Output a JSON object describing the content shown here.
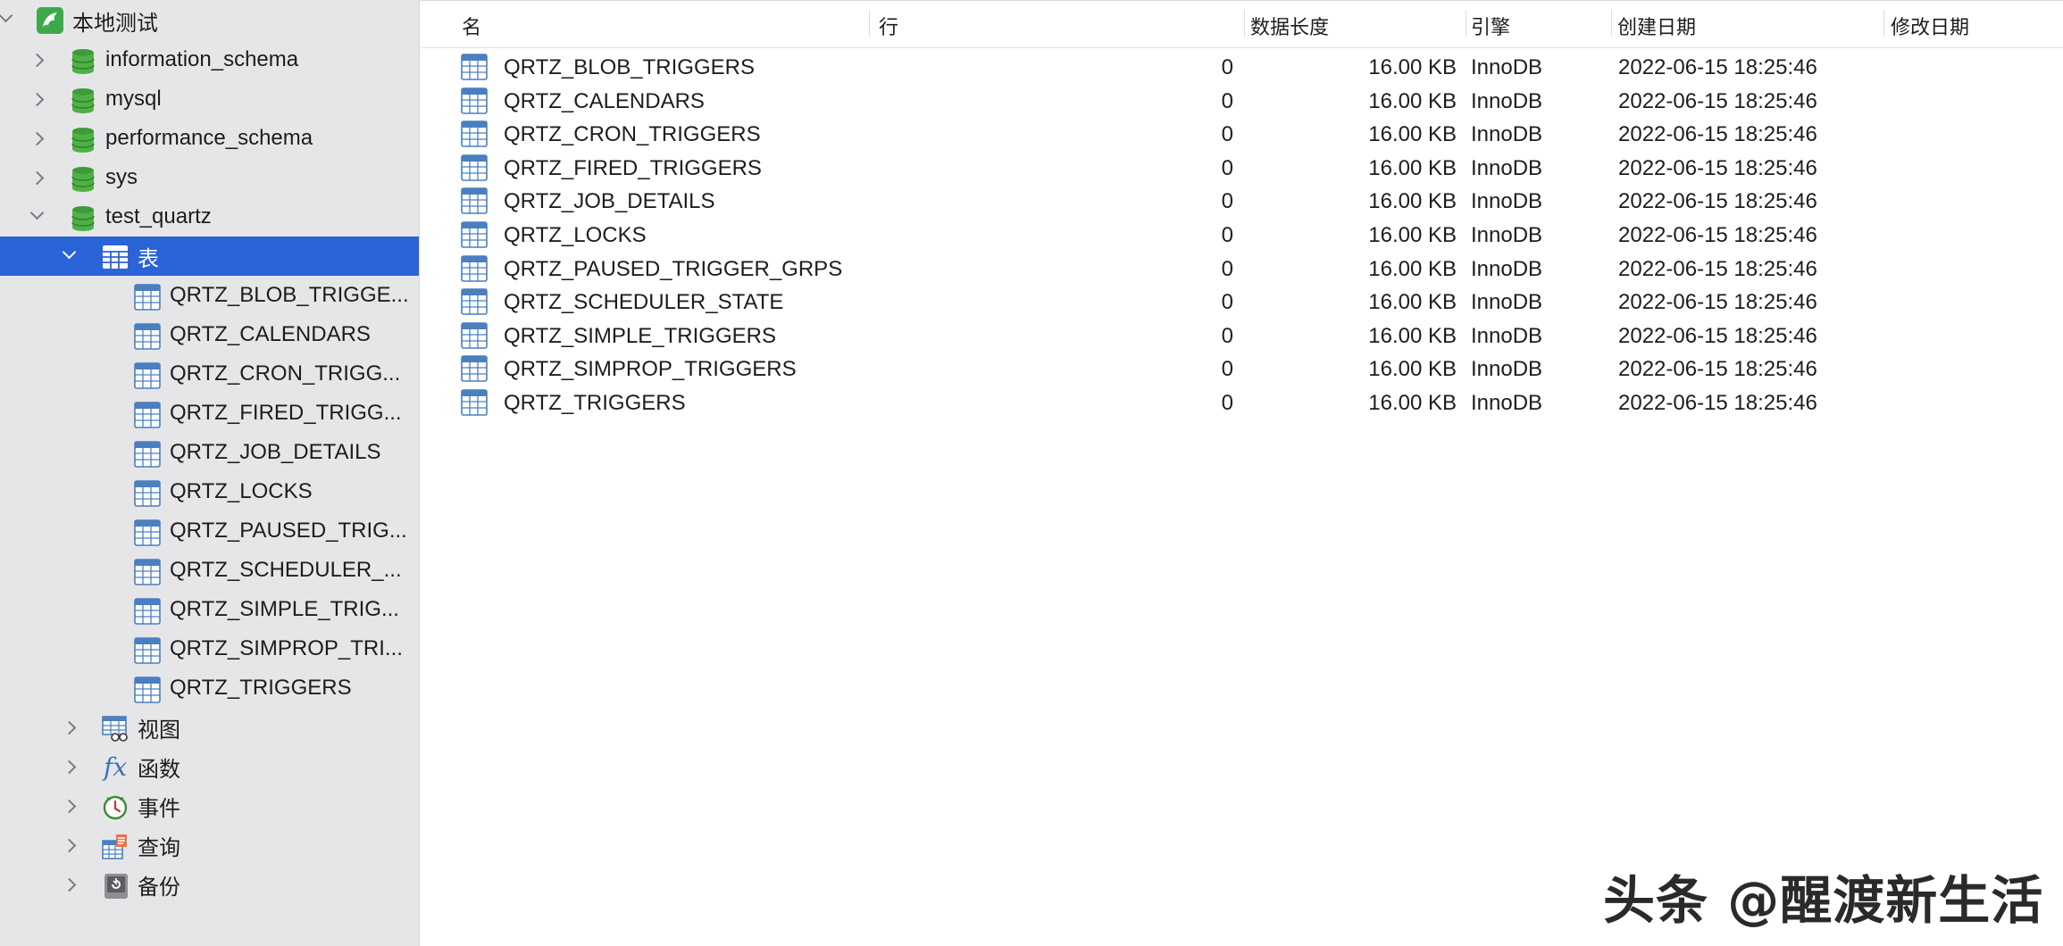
{
  "sidebar": {
    "connection": {
      "label": "本地测试",
      "icon": "dolphin-connection-icon"
    },
    "databases": [
      {
        "label": "information_schema",
        "icon": "database-icon"
      },
      {
        "label": "mysql",
        "icon": "database-icon"
      },
      {
        "label": "performance_schema",
        "icon": "database-icon"
      },
      {
        "label": "sys",
        "icon": "database-icon"
      },
      {
        "label": "test_quartz",
        "icon": "database-icon",
        "expanded": true
      }
    ],
    "tables_group": {
      "label": "表",
      "selected": true
    },
    "tables": [
      "QRTZ_BLOB_TRIGGE...",
      "QRTZ_CALENDARS",
      "QRTZ_CRON_TRIGG...",
      "QRTZ_FIRED_TRIGG...",
      "QRTZ_JOB_DETAILS",
      "QRTZ_LOCKS",
      "QRTZ_PAUSED_TRIG...",
      "QRTZ_SCHEDULER_...",
      "QRTZ_SIMPLE_TRIG...",
      "QRTZ_SIMPROP_TRI...",
      "QRTZ_TRIGGERS"
    ],
    "other_groups": [
      {
        "label": "视图",
        "icon": "view-icon"
      },
      {
        "label": "函数",
        "icon": "function-icon"
      },
      {
        "label": "事件",
        "icon": "event-clock-icon"
      },
      {
        "label": "查询",
        "icon": "query-icon"
      },
      {
        "label": "备份",
        "icon": "backup-icon"
      }
    ]
  },
  "table_view": {
    "columns": {
      "name": "名",
      "rows": "行",
      "data_length": "数据长度",
      "engine": "引擎",
      "created": "创建日期",
      "modified": "修改日期"
    },
    "rows": [
      {
        "name": "QRTZ_BLOB_TRIGGERS",
        "rows": "0",
        "data_length": "16.00 KB",
        "engine": "InnoDB",
        "created": "2022-06-15 18:25:46",
        "modified": ""
      },
      {
        "name": "QRTZ_CALENDARS",
        "rows": "0",
        "data_length": "16.00 KB",
        "engine": "InnoDB",
        "created": "2022-06-15 18:25:46",
        "modified": ""
      },
      {
        "name": "QRTZ_CRON_TRIGGERS",
        "rows": "0",
        "data_length": "16.00 KB",
        "engine": "InnoDB",
        "created": "2022-06-15 18:25:46",
        "modified": ""
      },
      {
        "name": "QRTZ_FIRED_TRIGGERS",
        "rows": "0",
        "data_length": "16.00 KB",
        "engine": "InnoDB",
        "created": "2022-06-15 18:25:46",
        "modified": ""
      },
      {
        "name": "QRTZ_JOB_DETAILS",
        "rows": "0",
        "data_length": "16.00 KB",
        "engine": "InnoDB",
        "created": "2022-06-15 18:25:46",
        "modified": ""
      },
      {
        "name": "QRTZ_LOCKS",
        "rows": "0",
        "data_length": "16.00 KB",
        "engine": "InnoDB",
        "created": "2022-06-15 18:25:46",
        "modified": ""
      },
      {
        "name": "QRTZ_PAUSED_TRIGGER_GRPS",
        "rows": "0",
        "data_length": "16.00 KB",
        "engine": "InnoDB",
        "created": "2022-06-15 18:25:46",
        "modified": ""
      },
      {
        "name": "QRTZ_SCHEDULER_STATE",
        "rows": "0",
        "data_length": "16.00 KB",
        "engine": "InnoDB",
        "created": "2022-06-15 18:25:46",
        "modified": ""
      },
      {
        "name": "QRTZ_SIMPLE_TRIGGERS",
        "rows": "0",
        "data_length": "16.00 KB",
        "engine": "InnoDB",
        "created": "2022-06-15 18:25:46",
        "modified": ""
      },
      {
        "name": "QRTZ_SIMPROP_TRIGGERS",
        "rows": "0",
        "data_length": "16.00 KB",
        "engine": "InnoDB",
        "created": "2022-06-15 18:25:46",
        "modified": ""
      },
      {
        "name": "QRTZ_TRIGGERS",
        "rows": "0",
        "data_length": "16.00 KB",
        "engine": "InnoDB",
        "created": "2022-06-15 18:25:46",
        "modified": ""
      }
    ]
  },
  "watermark": "头条 @醒渡新生活",
  "colors": {
    "sidebar_bg": "#e6e6e8",
    "selection": "#2b63d9",
    "database_green": "#3e9a3a",
    "table_icon_blue": "#4a7fc0"
  }
}
